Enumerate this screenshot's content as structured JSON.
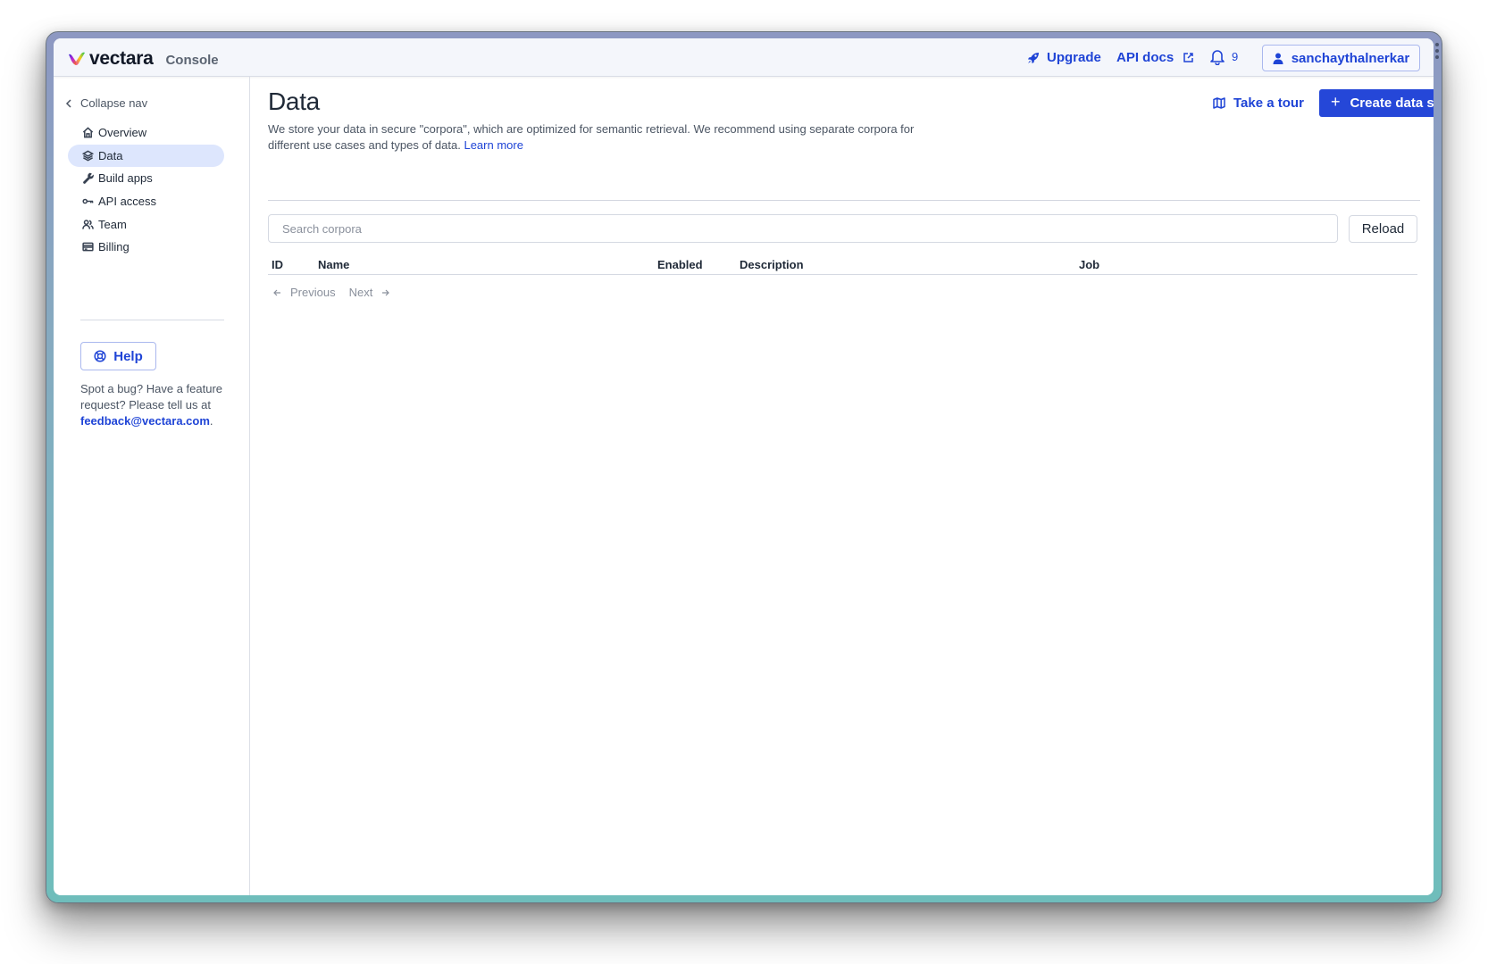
{
  "app": {
    "brand": "vectara",
    "section": "Console"
  },
  "topbar": {
    "upgrade_label": "Upgrade",
    "api_docs_label": "API docs",
    "notification_count": "9",
    "username": "sanchaythalnerkar"
  },
  "sidebar": {
    "collapse_label": "Collapse nav",
    "items": [
      {
        "label": "Overview",
        "icon": "home-icon",
        "active": false
      },
      {
        "label": "Data",
        "icon": "layers-icon",
        "active": true
      },
      {
        "label": "Build apps",
        "icon": "wrench-icon",
        "active": false
      },
      {
        "label": "API access",
        "icon": "key-icon",
        "active": false
      },
      {
        "label": "Team",
        "icon": "users-icon",
        "active": false
      },
      {
        "label": "Billing",
        "icon": "credit-card-icon",
        "active": false
      }
    ],
    "help_label": "Help",
    "feedback_text": "Spot a bug? Have a feature request? Please tell us at ",
    "feedback_email": "feedback@vectara.com",
    "feedback_suffix": "."
  },
  "main": {
    "title": "Data",
    "intro": "We store your data in secure \"corpora\", which are optimized for semantic retrieval. We recommend using separate corpora for different use cases and types of data. ",
    "learn_more": "Learn more",
    "tour_label": "Take a tour",
    "create_label": "Create data store",
    "search_placeholder": "Search corpora",
    "search_value": "",
    "reload_label": "Reload",
    "table": {
      "columns": [
        "ID",
        "Name",
        "Enabled",
        "Description",
        "Job"
      ],
      "rows": []
    },
    "pagination": {
      "previous": "Previous",
      "next": "Next"
    }
  },
  "colors": {
    "accent": "#2547d8",
    "link": "#1f44d6",
    "nav_active_bg": "#dde6fd",
    "topbar_bg": "#f4f6fb"
  }
}
